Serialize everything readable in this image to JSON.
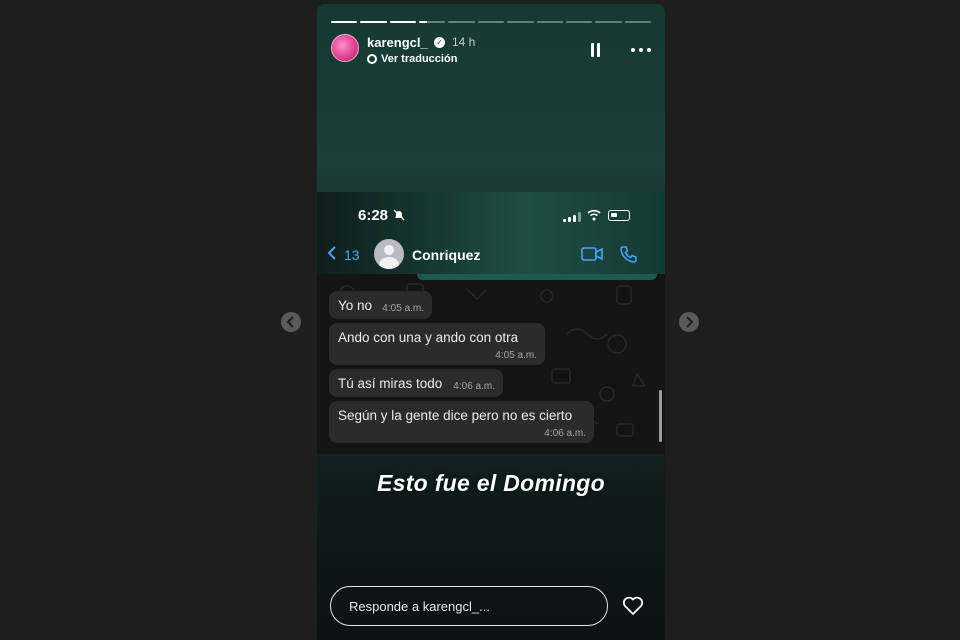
{
  "story": {
    "progress": {
      "total_segments": 11,
      "completed_segments": 3,
      "current_segment_progress": 0.3
    },
    "header": {
      "username": "karengcl_",
      "time_ago": "14 h",
      "translate_label": "Ver traducción",
      "pause_icon": "pause-icon",
      "more_icon": "more-options-icon"
    },
    "embedded_screenshot": {
      "status_time": "6:28",
      "back_count": "13",
      "contact_name": "Conriquez",
      "messages": [
        {
          "text": "Yo no",
          "time": "4:05 a.m."
        },
        {
          "text": "Ando con una y ando con otra",
          "time": "4:05 a.m."
        },
        {
          "text": "Tú así miras todo",
          "time": "4:06 a.m."
        },
        {
          "text": "Según y la gente dice pero no es cierto",
          "time": "4:06 a.m."
        }
      ]
    },
    "caption": "Esto fue el Domingo",
    "reply": {
      "placeholder": "Responde a karengcl_..."
    },
    "like_icon": "heart-icon"
  },
  "navigation": {
    "prev_icon": "chevron-left-icon",
    "next_icon": "chevron-right-icon"
  },
  "colors": {
    "page_bg": "#1e1e1e",
    "story_bg": "#163a33",
    "link_blue": "#4aa3ff",
    "bubble_bg": "#2b2b2b"
  }
}
